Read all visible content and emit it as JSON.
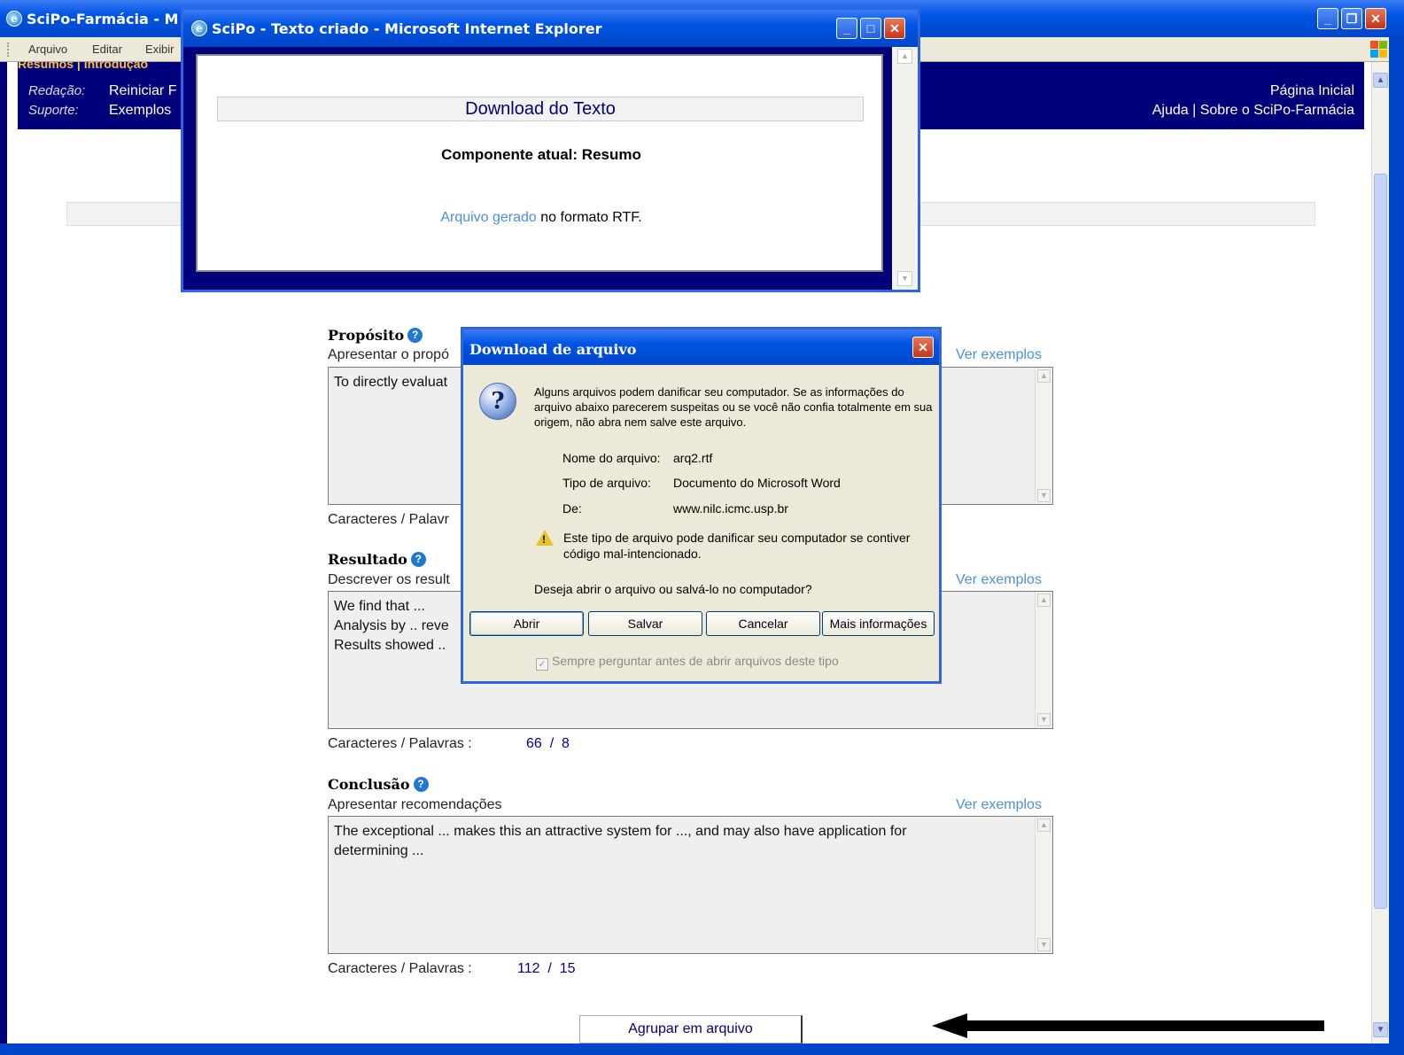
{
  "main_window": {
    "title": "SciPo-Farmácia - Mi",
    "menu": [
      "Arquivo",
      "Editar",
      "Exibir"
    ],
    "nav_tabs": "Resumos | Introdução",
    "nav": {
      "redacao_label": "Redação:",
      "redacao_link": "Reiniciar F",
      "suporte_label": "Suporte:",
      "suporte_link": "Exemplos",
      "pagina_inicial": "Página Inicial",
      "ajuda_sobre": "Ajuda | Sobre o SciPo-Farmácia"
    }
  },
  "sections": {
    "proposito": {
      "title": "Propósito",
      "desc": "Apresentar o propó",
      "ver_exemplos": "Ver exemplos",
      "text": "To directly evaluat",
      "count_label": "Caracteres / Palavr"
    },
    "resultado": {
      "title": "Resultado",
      "desc": "Descrever os result",
      "ver_exemplos": "Ver exemplos",
      "lines": [
        "We find that ...",
        "Analysis by .. reve",
        "Results showed .."
      ],
      "count_label": "Caracteres / Palavras :",
      "count_value": "66  /  8"
    },
    "conclusao": {
      "title": "Conclusão",
      "desc": "Apresentar recomendações",
      "ver_exemplos": "Ver exemplos",
      "text": "The exceptional ... makes this an attractive system for ..., and may also have application for determining ...",
      "count_label": "Caracteres / Palavras :",
      "count_value": "112  /  15"
    }
  },
  "agrupar_button": "Agrupar em arquivo",
  "popup": {
    "title": "SciPo - Texto criado - Microsoft Internet Explorer",
    "header": "Download do Texto",
    "component": "Componente atual: Resumo",
    "arquivo_link": "Arquivo gerado",
    "arquivo_rest": " no formato RTF."
  },
  "dialog": {
    "title": "Download de arquivo",
    "warning": "Alguns arquivos podem danificar seu computador. Se as informações do arquivo abaixo parecerem suspeitas ou se você não confia totalmente em sua origem, não abra nem salve este arquivo.",
    "nome_label": "Nome do arquivo:",
    "nome_value": "arq2.rtf",
    "tipo_label": "Tipo de arquivo:",
    "tipo_value": "Documento do Microsoft Word",
    "de_label": "De:",
    "de_value": "www.nilc.icmc.usp.br",
    "warning2": "Este tipo de arquivo pode danificar seu computador se contiver código mal-intencionado.",
    "question": "Deseja abrir o arquivo ou salvá-lo no computador?",
    "buttons": {
      "abrir": "Abrir",
      "salvar": "Salvar",
      "cancelar": "Cancelar",
      "mais": "Mais informações"
    },
    "checkbox": "Sempre perguntar antes de abrir arquivos deste tipo"
  },
  "colors": {
    "nav_bg": "#00007a",
    "link": "#4a8fe0",
    "xp_title": "#0054e3"
  }
}
